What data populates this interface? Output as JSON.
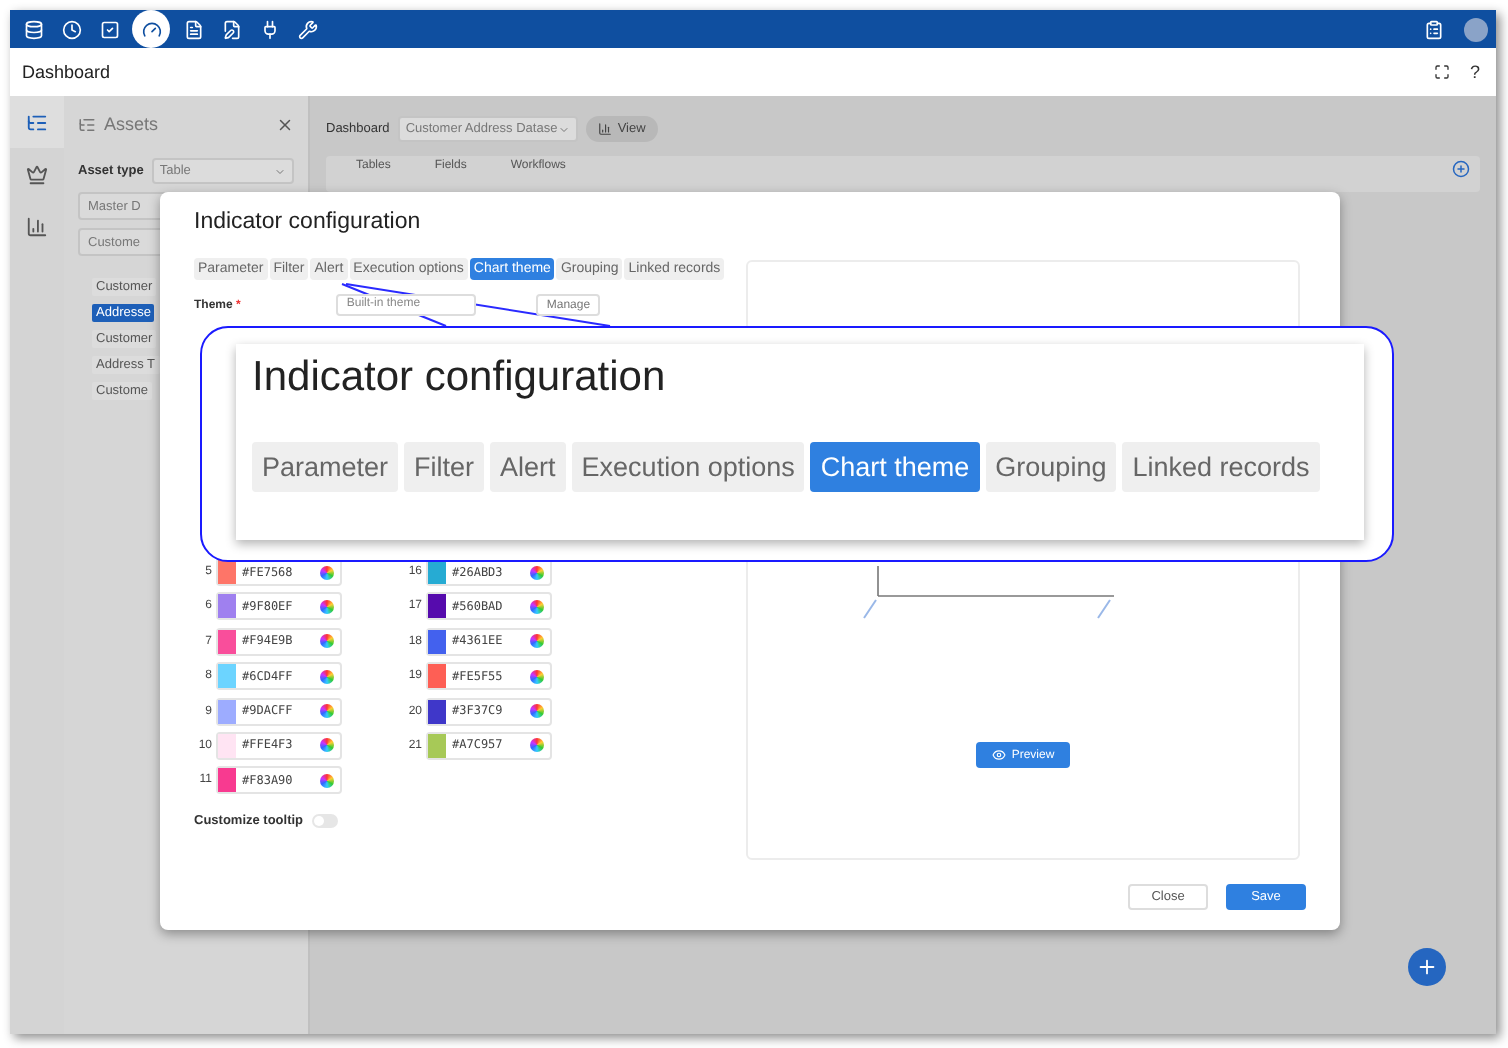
{
  "nav_items": [
    {
      "kind": "database",
      "selected": false
    },
    {
      "kind": "clock",
      "selected": false
    },
    {
      "kind": "check",
      "selected": false
    },
    {
      "kind": "gauge",
      "selected": true
    },
    {
      "kind": "file",
      "selected": false
    },
    {
      "kind": "edit",
      "selected": false
    },
    {
      "kind": "plug",
      "selected": false
    },
    {
      "kind": "wrench",
      "selected": false
    }
  ],
  "page_title": "Dashboard",
  "help": "?",
  "rail_items": [
    {
      "kind": "tree",
      "selected": true
    },
    {
      "kind": "crown",
      "selected": false
    },
    {
      "kind": "chart",
      "selected": false
    }
  ],
  "assets": {
    "title": "Assets",
    "asset_type_label": "Asset type",
    "asset_type": "Table",
    "filters": [
      "Master D",
      "Custome"
    ],
    "items": [
      {
        "label": "Customer",
        "selected": false
      },
      {
        "label": "Addresse",
        "selected": true
      },
      {
        "label": "Customer",
        "selected": false
      },
      {
        "label": "Address T",
        "selected": false
      },
      {
        "label": "Custome",
        "selected": false
      }
    ]
  },
  "toolbar": {
    "label": "Dashboard",
    "dataset": "Customer Address Datase",
    "view": "View"
  },
  "strip_tabs": [
    "Tables",
    "Fields",
    "Workflows"
  ],
  "modal": {
    "title": "Indicator configuration",
    "tabs": [
      {
        "label": "Parameter",
        "selected": false
      },
      {
        "label": "Filter",
        "selected": false
      },
      {
        "label": "Alert",
        "selected": false
      },
      {
        "label": "Execution options",
        "selected": false
      },
      {
        "label": "Chart theme",
        "selected": true
      },
      {
        "label": "Grouping",
        "selected": false
      },
      {
        "label": "Linked records",
        "selected": false
      }
    ],
    "theme_label": "Theme",
    "required_mark": "*",
    "theme_value": "Built-in theme",
    "manage": "Manage",
    "colors": [
      {
        "index": "5",
        "hex": "#FE7568",
        "color": "#fe7568"
      },
      {
        "index": "6",
        "hex": "#9F80EF",
        "color": "#9f80ef"
      },
      {
        "index": "7",
        "hex": "#F94E9B",
        "color": "#f94e9b"
      },
      {
        "index": "8",
        "hex": "#6CD4FF",
        "color": "#6cd4ff"
      },
      {
        "index": "9",
        "hex": "#9DACFF",
        "color": "#9dacff"
      },
      {
        "index": "10",
        "hex": "#FFE4F3",
        "color": "#ffe4f3"
      },
      {
        "index": "11",
        "hex": "#F83A90",
        "color": "#f83a90"
      },
      {
        "index": "16",
        "hex": "#26ABD3",
        "color": "#26abd3"
      },
      {
        "index": "17",
        "hex": "#560BAD",
        "color": "#560bad"
      },
      {
        "index": "18",
        "hex": "#4361EE",
        "color": "#4361ee"
      },
      {
        "index": "19",
        "hex": "#FE5F55",
        "color": "#fe5f55"
      },
      {
        "index": "20",
        "hex": "#3F37C9",
        "color": "#3f37c9"
      },
      {
        "index": "21",
        "hex": "#A7C957",
        "color": "#a7c957"
      }
    ],
    "customize_tooltip": {
      "label": "Customize tooltip",
      "on": false
    },
    "preview": "Preview",
    "close": "Close",
    "save": "Save"
  },
  "callout": {
    "title": "Indicator configuration",
    "tabs": [
      {
        "label": "Parameter",
        "selected": false
      },
      {
        "label": "Filter",
        "selected": false
      },
      {
        "label": "Alert",
        "selected": false
      },
      {
        "label": "Execution options",
        "selected": false
      },
      {
        "label": "Chart theme",
        "selected": true
      },
      {
        "label": "Grouping",
        "selected": false
      },
      {
        "label": "Linked records",
        "selected": false
      }
    ]
  }
}
